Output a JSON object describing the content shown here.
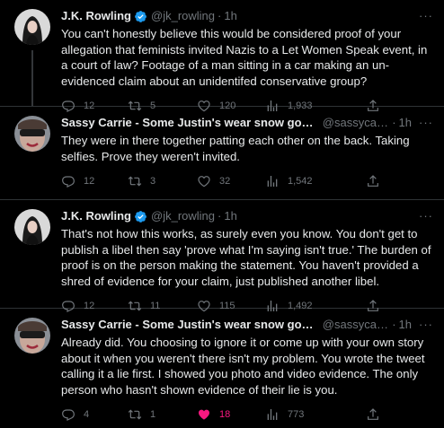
{
  "tweets": [
    {
      "name": "J.K. Rowling",
      "verified": true,
      "handle": "@jk_rowling",
      "dot": "·",
      "time": "1h",
      "more": "···",
      "text": "You can't honestly believe this would be considered proof of your allegation that feminists invited Nazis to a Let Women Speak event, in a court of law? Footage of a man sitting in a car making an un-evidenced claim about an unidentifed conservative group?",
      "replies": "12",
      "retweets": "5",
      "likes": "120",
      "views": "1,933",
      "liked": false
    },
    {
      "name": "Sassy Carrie - Some Justin's wear snow goggl...",
      "verified": false,
      "handle": "@sassycarr...",
      "dot": "·",
      "time": "1h",
      "more": "···",
      "text": "They were in there together patting each other on the back. Taking selfies. Prove they weren't invited.",
      "replies": "12",
      "retweets": "3",
      "likes": "32",
      "views": "1,542",
      "liked": false
    },
    {
      "name": "J.K. Rowling",
      "verified": true,
      "handle": "@jk_rowling",
      "dot": "·",
      "time": "1h",
      "more": "···",
      "text": "That's not how this works, as surely even you know. You don't get to publish a libel then say 'prove what I'm saying isn't true.' The burden of proof is on the person making the statement. You haven't provided a shred of evidence for your claim, just published another libel.",
      "replies": "12",
      "retweets": "11",
      "likes": "115",
      "views": "1,492",
      "liked": false
    },
    {
      "name": "Sassy Carrie - Some Justin's wear snow goggl...",
      "verified": false,
      "handle": "@sassycarr...",
      "dot": "·",
      "time": "1h",
      "more": "···",
      "text": "Already did. You choosing to ignore it or come up with your own story about it when you weren't there isn't my problem. You wrote the tweet calling it a lie first. I showed you photo and video evidence. The only person who hasn't shown evidence of their lie is you.",
      "replies": "4",
      "retweets": "1",
      "likes": "18",
      "views": "773",
      "liked": true
    }
  ],
  "colors": {
    "background": "#000000",
    "text": "#e7e9ea",
    "muted": "#71767b",
    "verified": "#1d9bf0",
    "like_active": "#f91880",
    "thread_line": "#333639"
  },
  "icons": [
    "verified-badge-icon",
    "more-icon",
    "reply-icon",
    "retweet-icon",
    "like-icon",
    "views-icon",
    "share-icon"
  ]
}
